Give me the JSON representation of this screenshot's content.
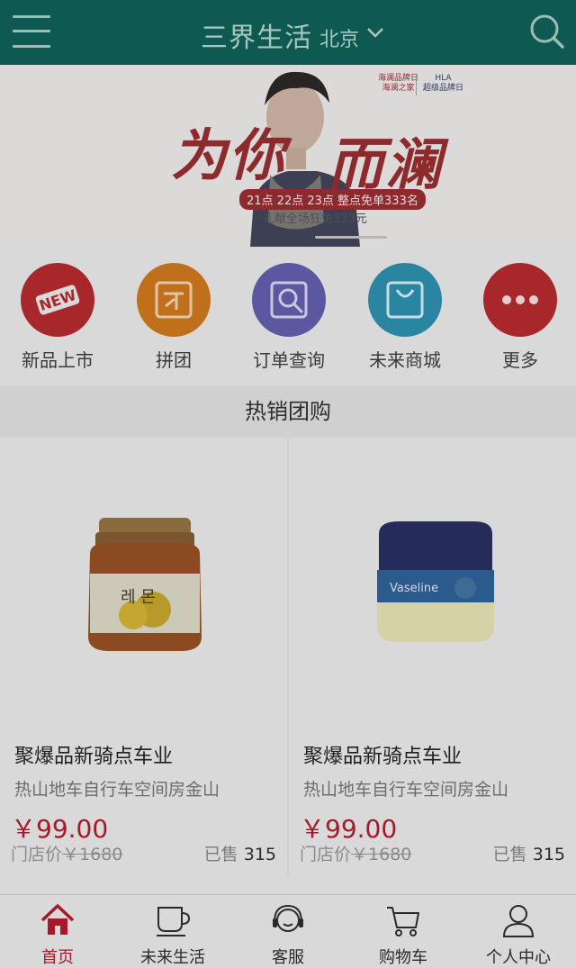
{
  "header": {
    "brand": "三界生活",
    "city": "北京",
    "icons": {
      "menu": "menu-icon",
      "city_dropdown": "chevron-down-icon",
      "search": "search-icon"
    }
  },
  "banner": {
    "slogan_left": "为你",
    "slogan_right": "而澜",
    "promo": "21点 22点 23点 整点免单333名",
    "gift": "礼献全场狂免333元",
    "logo_a_line1": "海澜品牌日",
    "logo_a_line2": "海澜之家",
    "logo_b_line1": "HLA",
    "logo_b_line2": "超级品牌日"
  },
  "quick_nav": [
    {
      "label": "新品上市",
      "icon": "new-badge-icon",
      "color": "#a8272b",
      "badge": "NEW"
    },
    {
      "label": "拼团",
      "icon": "group-buy-icon",
      "color": "#c0701a"
    },
    {
      "label": "订单查询",
      "icon": "order-search-icon",
      "color": "#5b57a0"
    },
    {
      "label": "未来商城",
      "icon": "shopping-bag-icon",
      "color": "#2a86a0"
    },
    {
      "label": "更多",
      "icon": "more-dots-icon",
      "color": "#a8272b"
    }
  ],
  "section": {
    "title": "热销团购"
  },
  "products": [
    {
      "image": "honey-lemon-jar-image",
      "title": "聚爆品新骑点车业",
      "subtitle": "热山地车自行车空间房金山",
      "price": "￥99.00",
      "orig_label": "门店价",
      "orig_price": "￥1680",
      "sold_label": "已售",
      "sold_count": "315"
    },
    {
      "image": "vaseline-jar-image",
      "title": "聚爆品新骑点车业",
      "subtitle": "热山地车自行车空间房金山",
      "price": "￥99.00",
      "orig_label": "门店价",
      "orig_price": "￥1680",
      "sold_label": "已售",
      "sold_count": "315"
    }
  ],
  "tabbar": [
    {
      "label": "首页",
      "icon": "home-icon",
      "active": true
    },
    {
      "label": "未来生活",
      "icon": "coffee-cup-icon",
      "active": false
    },
    {
      "label": "客服",
      "icon": "headset-icon",
      "active": false
    },
    {
      "label": "购物车",
      "icon": "cart-icon",
      "active": false
    },
    {
      "label": "个人中心",
      "icon": "user-icon",
      "active": false
    }
  ],
  "colors": {
    "header_bg": "#0e5a52",
    "accent": "#a41a28",
    "overlay_bg": "#d9d9d9"
  }
}
